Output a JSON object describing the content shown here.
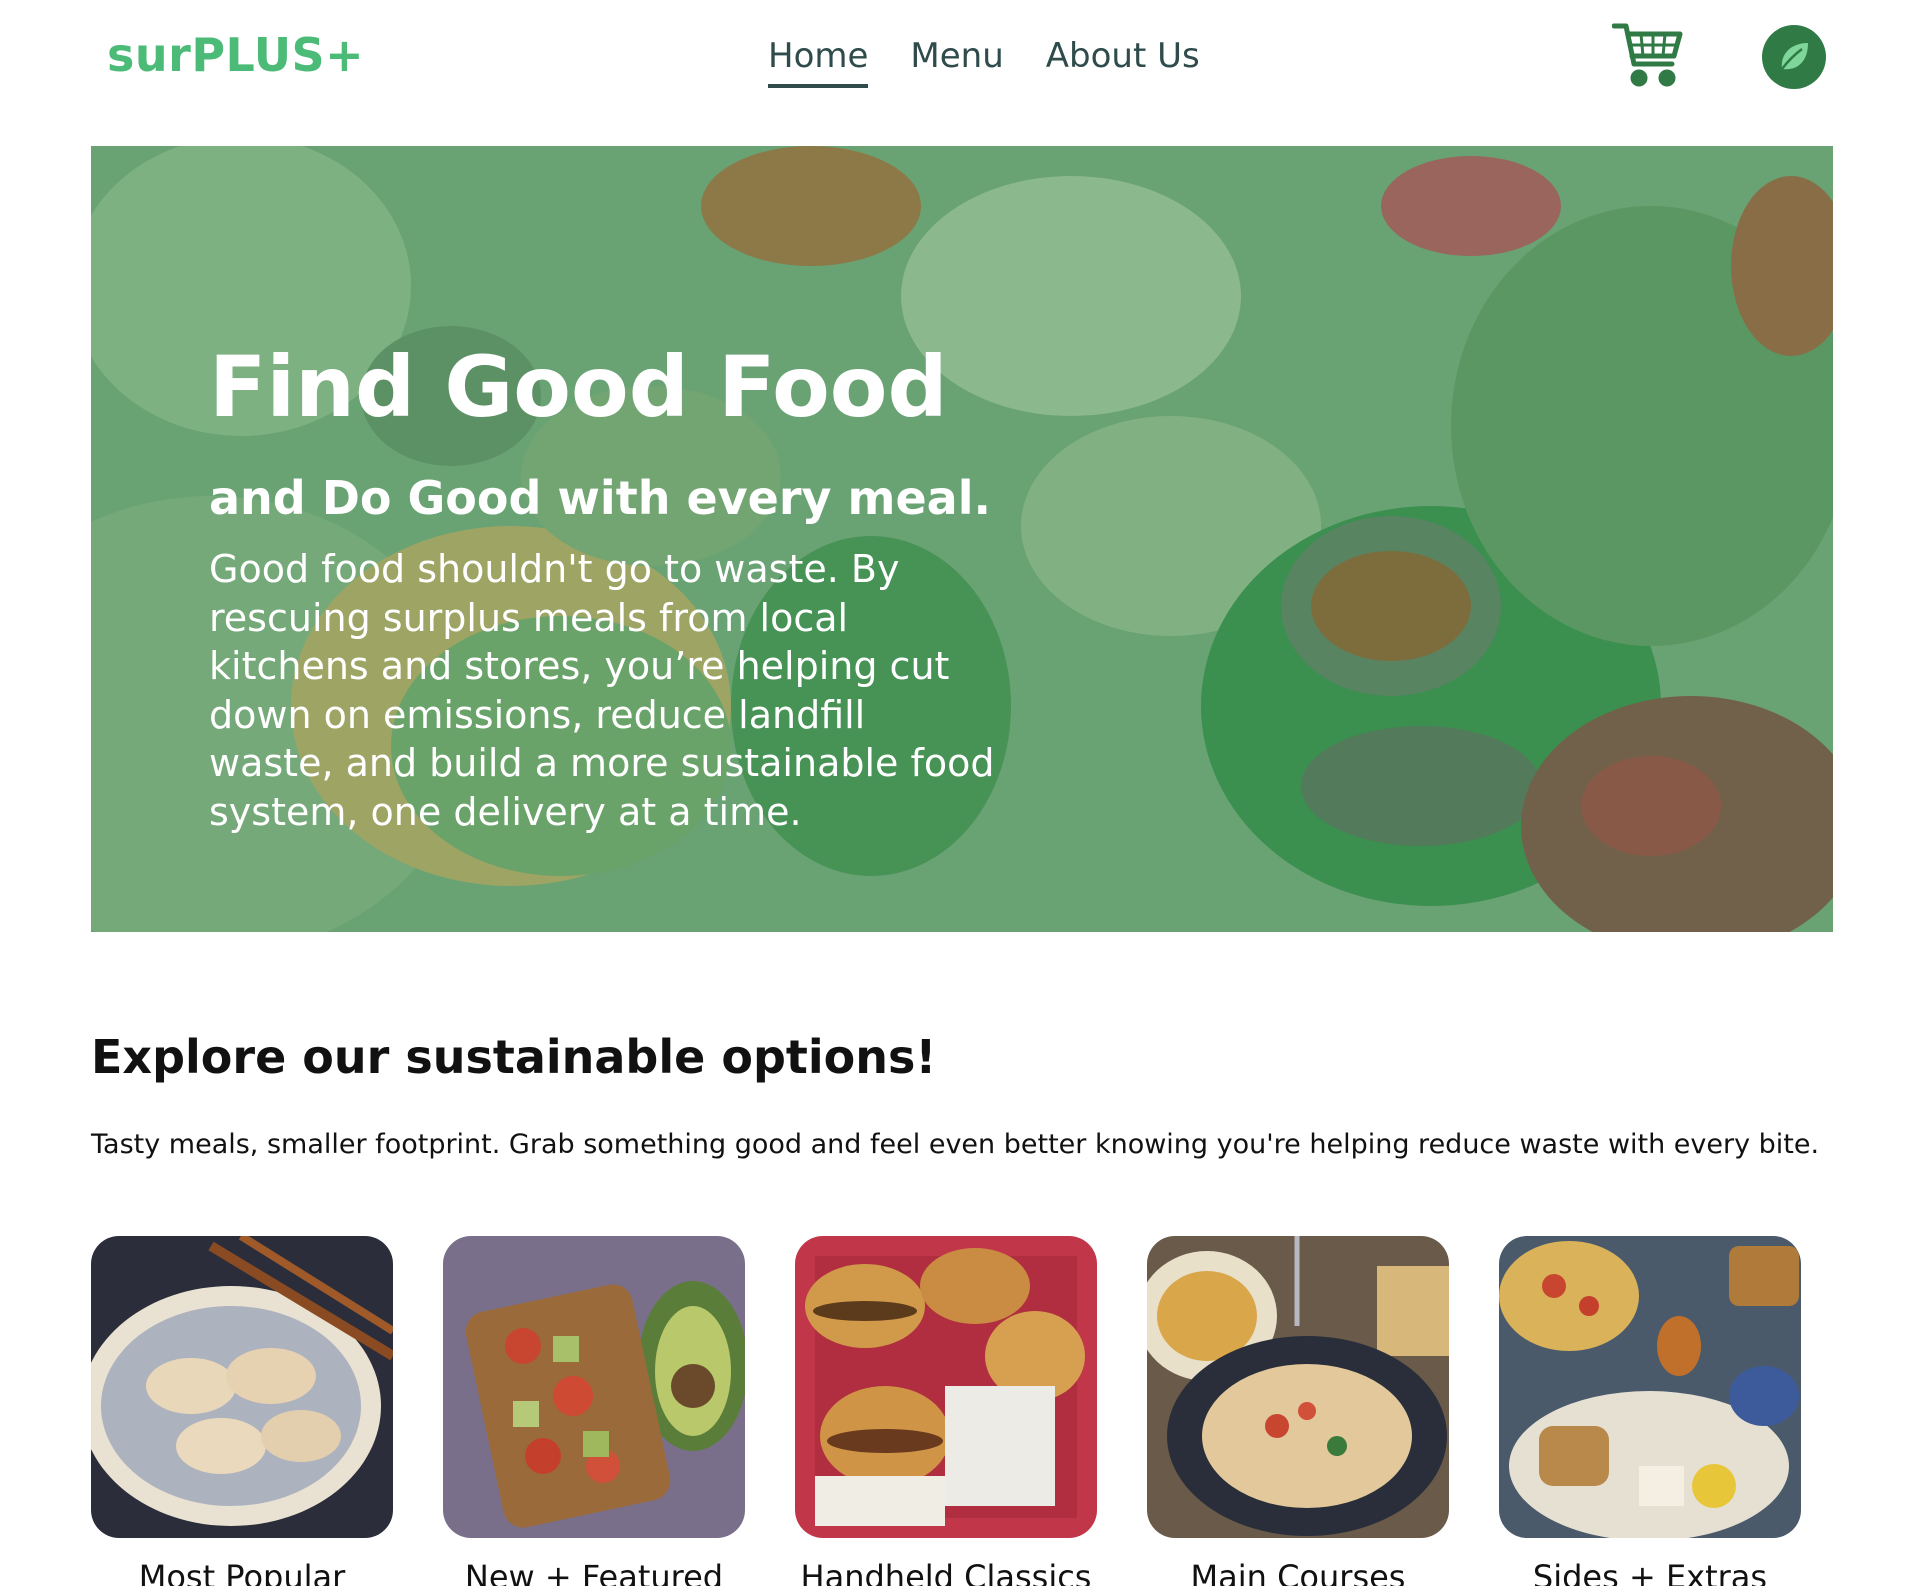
{
  "header": {
    "logo": "surPLUS+",
    "nav": [
      {
        "label": "Home",
        "active": true
      },
      {
        "label": "Menu",
        "active": false
      },
      {
        "label": "About Us",
        "active": false
      }
    ],
    "cart_icon": "shopping-cart-icon",
    "avatar_icon": "leaf-icon"
  },
  "hero": {
    "title": "Find Good Food",
    "subtitle": "and Do Good with every meal.",
    "description": "Good food shouldn't go to waste. By rescuing surplus meals from local kitchens and stores, you’re helping cut down on emissions, reduce landfill waste, and build a more sustainable food system, one delivery at a time."
  },
  "explore": {
    "title": "Explore our sustainable options!",
    "description": "Tasty meals, smaller footprint. Grab something good and feel even better knowing you're helping reduce waste with every bite."
  },
  "categories": [
    {
      "label": "Most Popular"
    },
    {
      "label": "New + Featured"
    },
    {
      "label": "Handheld Classics"
    },
    {
      "label": "Main Courses"
    },
    {
      "label": "Sides + Extras"
    }
  ],
  "colors": {
    "brand_green": "#4dbb78",
    "nav_text": "#2f4b4b",
    "avatar_bg": "#2f7a45",
    "cart_green": "#2f7a45",
    "hero_overlay": "#5f9e6c"
  }
}
